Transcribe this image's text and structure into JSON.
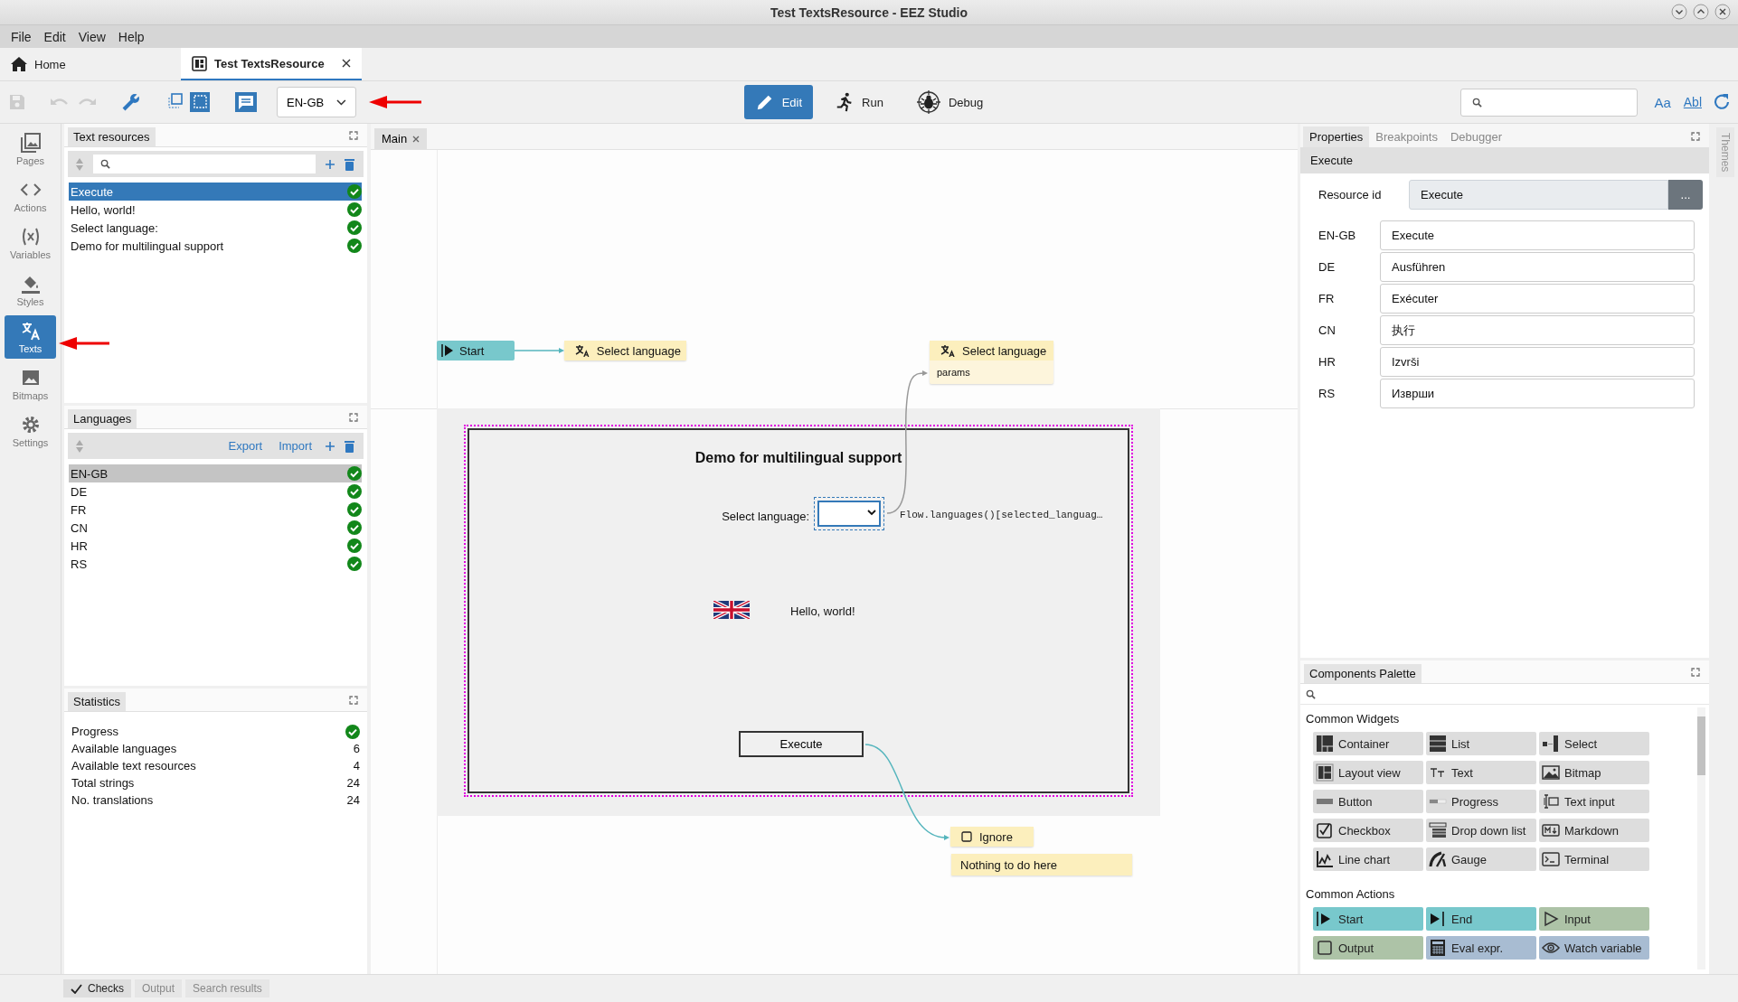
{
  "window": {
    "title": "Test TextsResource - EEZ Studio"
  },
  "menu": [
    "File",
    "Edit",
    "View",
    "Help"
  ],
  "tabs": [
    {
      "label": "Home",
      "kind": "home",
      "selected": false
    },
    {
      "label": "Test TextsResource",
      "kind": "page",
      "selected": true
    }
  ],
  "toolbar": {
    "language": "EN-GB",
    "modes": [
      {
        "label": "Edit",
        "kind": "edit",
        "selected": true
      },
      {
        "label": "Run",
        "kind": "run",
        "selected": false
      },
      {
        "label": "Debug",
        "kind": "debug",
        "selected": false
      }
    ],
    "search_options": [
      "Aa",
      "Abl"
    ]
  },
  "sidebar": [
    {
      "label": "Pages",
      "kind": "pages",
      "selected": false
    },
    {
      "label": "Actions",
      "kind": "actions",
      "selected": false
    },
    {
      "label": "Variables",
      "kind": "variables",
      "selected": false
    },
    {
      "label": "Styles",
      "kind": "styles",
      "selected": false
    },
    {
      "label": "Texts",
      "kind": "texts",
      "selected": true
    },
    {
      "label": "Bitmaps",
      "kind": "bitmaps",
      "selected": false
    },
    {
      "label": "Settings",
      "kind": "settings",
      "selected": false
    }
  ],
  "text_resources": {
    "title": "Text resources",
    "items": [
      {
        "label": "Execute",
        "selected": true,
        "complete": true
      },
      {
        "label": "Hello, world!",
        "selected": false,
        "complete": true
      },
      {
        "label": "Select language:",
        "selected": false,
        "complete": true
      },
      {
        "label": "Demo for multilingual support",
        "selected": false,
        "complete": true
      }
    ]
  },
  "languages": {
    "title": "Languages",
    "actions": [
      "Export",
      "Import"
    ],
    "items": [
      {
        "label": "EN-GB",
        "selected": true,
        "complete": true
      },
      {
        "label": "DE",
        "selected": false,
        "complete": true
      },
      {
        "label": "FR",
        "selected": false,
        "complete": true
      },
      {
        "label": "CN",
        "selected": false,
        "complete": true
      },
      {
        "label": "HR",
        "selected": false,
        "complete": true
      },
      {
        "label": "RS",
        "selected": false,
        "complete": true
      }
    ]
  },
  "statistics": {
    "title": "Statistics",
    "rows": [
      {
        "label": "Progress",
        "kind": "check",
        "complete": true
      },
      {
        "label": "Available languages",
        "kind": "value",
        "value": "6"
      },
      {
        "label": "Available text resources",
        "kind": "value",
        "value": "4"
      },
      {
        "label": "Total strings",
        "kind": "value",
        "value": "24"
      },
      {
        "label": "No. translations",
        "kind": "value",
        "value": "24"
      }
    ]
  },
  "editor_tabs": [
    "Main"
  ],
  "flow": {
    "nodes": [
      {
        "kind": "start",
        "label": "Start"
      },
      {
        "kind": "language",
        "label": "Select language"
      },
      {
        "kind": "language",
        "label": "Select language",
        "input": "params"
      },
      {
        "kind": "ignore",
        "label": "Ignore"
      },
      {
        "kind": "comment",
        "label": "Nothing to do here"
      }
    ],
    "page": {
      "title": "Demo for multilingual support",
      "select_label": "Select language:",
      "expression": "Flow.languages()[selected_languag…",
      "text": "Hello, world!",
      "button": "Execute"
    }
  },
  "properties": {
    "tabs": [
      {
        "label": "Properties",
        "selected": true
      },
      {
        "label": "Breakpoints",
        "selected": false
      },
      {
        "label": "Debugger",
        "selected": false
      }
    ],
    "section": "Execute",
    "resource_id": {
      "label": "Resource id",
      "value": "Execute",
      "button": "..."
    },
    "translations": [
      {
        "language": "EN-GB",
        "value": "Execute"
      },
      {
        "language": "DE",
        "value": "Ausführen"
      },
      {
        "language": "FR",
        "value": "Exécuter"
      },
      {
        "language": "CN",
        "value": "执行"
      },
      {
        "language": "HR",
        "value": "Izvrši"
      },
      {
        "language": "RS",
        "value": "Изврши"
      }
    ]
  },
  "palette": {
    "title": "Components Palette",
    "groups": [
      {
        "title": "Common Widgets",
        "items": [
          {
            "label": "Container",
            "kind": "container",
            "color": "#dddddd"
          },
          {
            "label": "List",
            "kind": "list",
            "color": "#dddddd"
          },
          {
            "label": "Select",
            "kind": "select",
            "color": "#dddddd"
          },
          {
            "label": "Layout view",
            "kind": "layout",
            "color": "#dddddd"
          },
          {
            "label": "Text",
            "kind": "text",
            "color": "#dddddd"
          },
          {
            "label": "Bitmap",
            "kind": "bitmap",
            "color": "#dddddd"
          },
          {
            "label": "Button",
            "kind": "button",
            "color": "#dddddd"
          },
          {
            "label": "Progress",
            "kind": "progress",
            "color": "#dddddd"
          },
          {
            "label": "Text input",
            "kind": "textinput",
            "color": "#dddddd"
          },
          {
            "label": "Checkbox",
            "kind": "checkbox",
            "color": "#dddddd"
          },
          {
            "label": "Drop down list",
            "kind": "dropdown",
            "color": "#dddddd"
          },
          {
            "label": "Markdown",
            "kind": "markdown",
            "color": "#dddddd"
          },
          {
            "label": "Line chart",
            "kind": "linechart",
            "color": "#dddddd"
          },
          {
            "label": "Gauge",
            "kind": "gauge",
            "color": "#dddddd"
          },
          {
            "label": "Terminal",
            "kind": "terminal",
            "color": "#dddddd"
          }
        ]
      },
      {
        "title": "Common Actions",
        "items": [
          {
            "label": "Start",
            "kind": "start",
            "color": "#78c8cc"
          },
          {
            "label": "End",
            "kind": "end",
            "color": "#78c8cc"
          },
          {
            "label": "Input",
            "kind": "input",
            "color": "#adc3a7"
          },
          {
            "label": "Output",
            "kind": "output",
            "color": "#adc3a7"
          },
          {
            "label": "Eval expr.",
            "kind": "calc",
            "color": "#a8bcd2"
          },
          {
            "label": "Watch variable",
            "kind": "eye",
            "color": "#a8bcd2"
          }
        ]
      }
    ]
  },
  "themes_label": "Themes",
  "bottom_tabs": [
    {
      "label": "Checks",
      "selected": true
    },
    {
      "label": "Output",
      "selected": false
    },
    {
      "label": "Search results",
      "selected": false
    }
  ]
}
